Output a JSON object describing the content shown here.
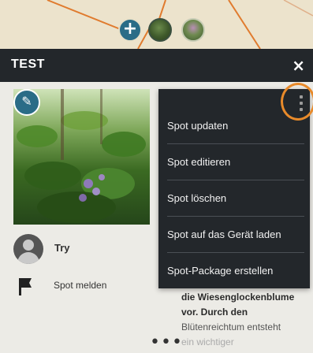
{
  "map": {
    "add_icon": "plus-icon",
    "add_symbol": "+",
    "thumbnail_icons": [
      "plant-photo-thumbnail",
      "flower-photo-thumbnail"
    ]
  },
  "header": {
    "title": "TEST",
    "close_symbol": "×"
  },
  "spot": {
    "edit_icon": "pencil-icon",
    "edit_symbol": "✎",
    "user_name": "Try",
    "report_label": "Spot melden",
    "description_lines": [
      "die Wiesenglockenblume",
      "vor. Durch den",
      "Blütenreichtum entsteht",
      "ein wichtiger"
    ],
    "more_symbol": "•••"
  },
  "menu": {
    "items": [
      "Spot updaten",
      "Spot editieren",
      "Spot löschen",
      "Spot auf das Gerät laden",
      "Spot-Package erstellen"
    ]
  },
  "colors": {
    "accent": "#2a6c87",
    "header_bg": "#23272b",
    "highlight": "#e88a2a"
  }
}
